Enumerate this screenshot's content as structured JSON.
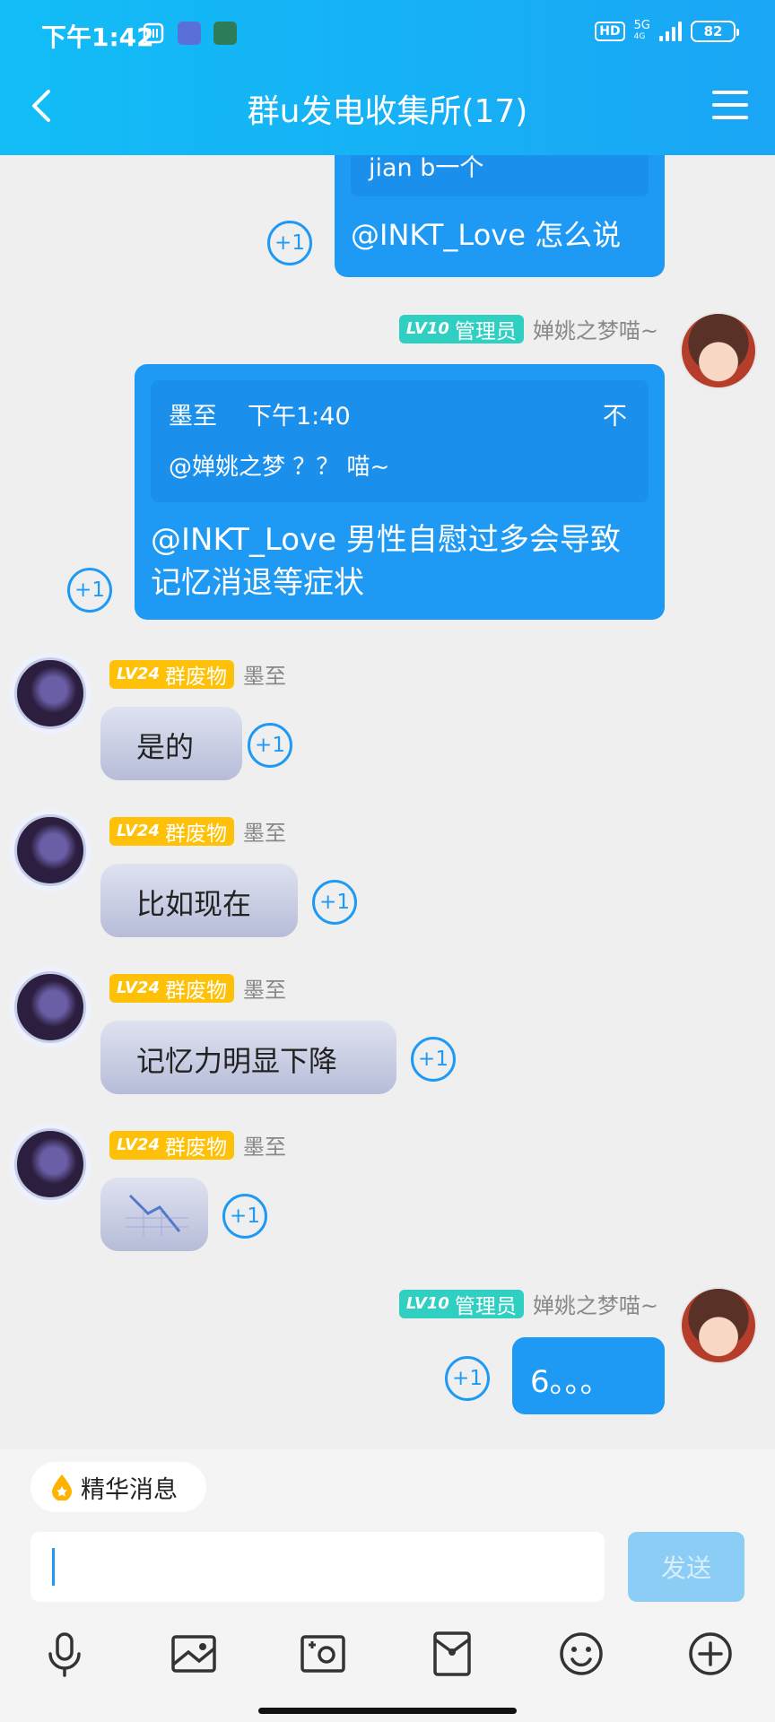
{
  "status_bar": {
    "time": "下午1:42",
    "network": "5G",
    "network_sub": "4G",
    "hd": "HD",
    "battery": "82"
  },
  "header": {
    "title": "群u发电收集所(17)"
  },
  "messages": {
    "m1": {
      "quote_tail": "jian b一个",
      "text": "@INKT_Love 怎么说",
      "plus": "+1"
    },
    "m2": {
      "level": "LV10",
      "role": "管理员",
      "nick": "婵姚之梦喵~",
      "quote_author": "墨至",
      "quote_time": "下午1:40",
      "quote_flag": "不",
      "quote_text": "@婵姚之梦 ？？ 喵~",
      "text": "@INKT_Love 男性自慰过多会导致记忆消退等症状",
      "plus": "+1"
    },
    "m3": {
      "level": "LV24",
      "role": "群废物",
      "nick": "墨至",
      "text": "是的",
      "plus": "+1"
    },
    "m4": {
      "level": "LV24",
      "role": "群废物",
      "nick": "墨至",
      "text": "比如现在",
      "plus": "+1"
    },
    "m5": {
      "level": "LV24",
      "role": "群废物",
      "nick": "墨至",
      "text": "记忆力明显下降",
      "plus": "+1"
    },
    "m6": {
      "level": "LV24",
      "role": "群废物",
      "nick": "墨至",
      "plus": "+1"
    },
    "m7": {
      "level": "LV10",
      "role": "管理员",
      "nick": "婵姚之梦喵~",
      "text": "6。。。",
      "plus": "+1"
    }
  },
  "bottom": {
    "essence_label": "精华消息",
    "input_value": "",
    "send_label": "发送"
  },
  "toolbar": {
    "icons": [
      "microphone-icon",
      "image-icon",
      "camera-icon",
      "red-packet-icon",
      "emoji-icon",
      "plus-icon"
    ]
  },
  "colors": {
    "header_start": "#12bdf6",
    "header_end": "#1aa6f5",
    "bubble": "#1e9af5",
    "admin_badge": "#2fd0c2",
    "member_badge": "#ffc107"
  }
}
